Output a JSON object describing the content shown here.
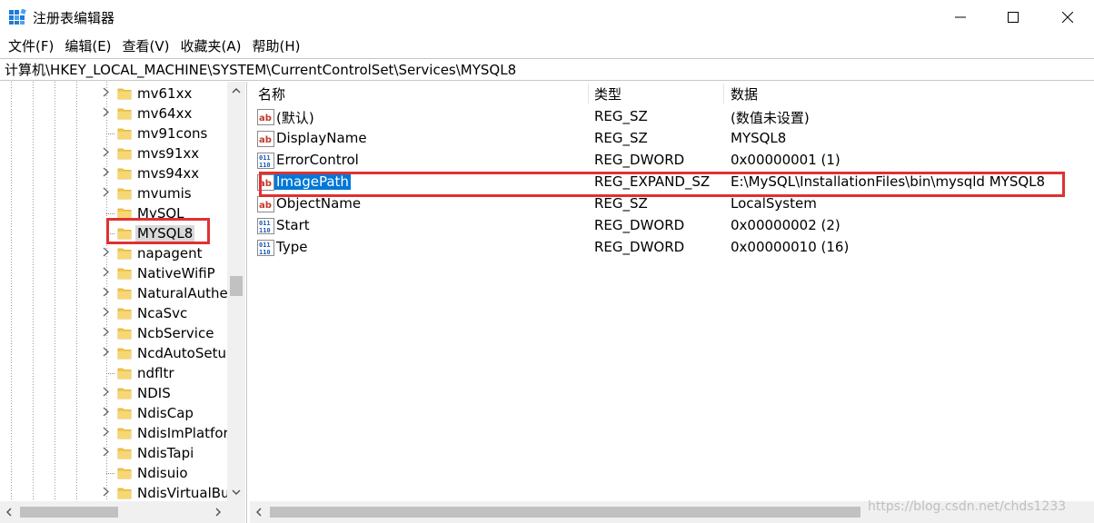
{
  "window": {
    "title": "注册表编辑器",
    "controls": {
      "minimize": "—",
      "maximize": "☐",
      "close": "✕"
    }
  },
  "menu": [
    "文件(F)",
    "编辑(E)",
    "查看(V)",
    "收藏夹(A)",
    "帮助(H)"
  ],
  "address": "计算机\\HKEY_LOCAL_MACHINE\\SYSTEM\\CurrentControlSet\\Services\\MYSQL8",
  "tree": {
    "items": [
      {
        "label": "mv61xx",
        "expandable": true
      },
      {
        "label": "mv64xx",
        "expandable": true
      },
      {
        "label": "mv91cons",
        "expandable": false
      },
      {
        "label": "mvs91xx",
        "expandable": true
      },
      {
        "label": "mvs94xx",
        "expandable": true
      },
      {
        "label": "mvumis",
        "expandable": true
      },
      {
        "label": "MySQL",
        "expandable": false
      },
      {
        "label": "MYSQL8",
        "expandable": false,
        "selected": true
      },
      {
        "label": "napagent",
        "expandable": true
      },
      {
        "label": "NativeWifiP",
        "expandable": true
      },
      {
        "label": "NaturalAuthe",
        "expandable": true
      },
      {
        "label": "NcaSvc",
        "expandable": true
      },
      {
        "label": "NcbService",
        "expandable": true
      },
      {
        "label": "NcdAutoSetu",
        "expandable": true
      },
      {
        "label": "ndfltr",
        "expandable": false
      },
      {
        "label": "NDIS",
        "expandable": true
      },
      {
        "label": "NdisCap",
        "expandable": true
      },
      {
        "label": "NdisImPlatfor",
        "expandable": true
      },
      {
        "label": "NdisTapi",
        "expandable": true
      },
      {
        "label": "Ndisuio",
        "expandable": false
      },
      {
        "label": "NdisVirtualBu",
        "expandable": true
      }
    ]
  },
  "columns": {
    "name": "名称",
    "type": "类型",
    "data": "数据"
  },
  "values": [
    {
      "name": "(默认)",
      "type": "REG_SZ",
      "data": "(数值未设置)",
      "icon": "string-value-icon"
    },
    {
      "name": "DisplayName",
      "type": "REG_SZ",
      "data": "MYSQL8",
      "icon": "string-value-icon"
    },
    {
      "name": "ErrorControl",
      "type": "REG_DWORD",
      "data": "0x00000001 (1)",
      "icon": "binary-value-icon"
    },
    {
      "name": "ImagePath",
      "type": "REG_EXPAND_SZ",
      "data": "E:\\MySQL\\InstallationFiles\\bin\\mysqld MYSQL8",
      "icon": "string-value-icon",
      "selected": true
    },
    {
      "name": "ObjectName",
      "type": "REG_SZ",
      "data": "LocalSystem",
      "icon": "string-value-icon"
    },
    {
      "name": "Start",
      "type": "REG_DWORD",
      "data": "0x00000002 (2)",
      "icon": "binary-value-icon"
    },
    {
      "name": "Type",
      "type": "REG_DWORD",
      "data": "0x00000010 (16)",
      "icon": "binary-value-icon"
    }
  ],
  "watermark": "https://blog.csdn.net/chds1233",
  "colors": {
    "selection": "#0078d7",
    "highlight_box": "#e03131",
    "folder": "#f2c94c"
  }
}
